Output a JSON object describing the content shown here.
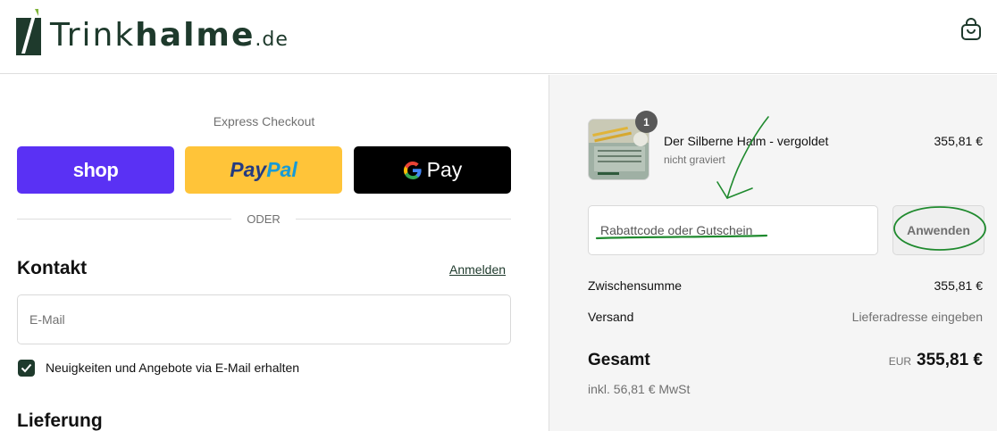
{
  "header": {
    "logo": {
      "part_light": "Trink",
      "part_bold": "halme",
      "tld": ".de"
    },
    "cart_icon": "shopping-bag-icon"
  },
  "express_checkout": {
    "title": "Express Checkout",
    "buttons": [
      {
        "id": "shop",
        "label": "shop"
      },
      {
        "id": "paypal",
        "label_part1": "Pay",
        "label_part2": "Pal"
      },
      {
        "id": "gpay",
        "label_g": "G",
        "label": "Pay"
      }
    ],
    "divider_label": "ODER"
  },
  "contact": {
    "title": "Kontakt",
    "login_link": "Anmelden",
    "email_placeholder": "E-Mail",
    "newsletter_label": "Neuigkeiten und Angebote via E-Mail erhalten",
    "newsletter_checked": true
  },
  "delivery": {
    "title": "Lieferung"
  },
  "order_summary": {
    "item": {
      "quantity": "1",
      "name": "Der Silberne Halm - vergoldet",
      "variant": "nicht graviert",
      "price": "355,81 €"
    },
    "discount": {
      "placeholder": "Rabattcode oder Gutschein",
      "apply_label": "Anwenden"
    },
    "subtotal_label": "Zwischensumme",
    "subtotal_value": "355,81 €",
    "shipping_label": "Versand",
    "shipping_value": "Lieferadresse eingeben",
    "total_label": "Gesamt",
    "total_currency": "EUR",
    "total_value": "355,81 €",
    "tax_note": "inkl. 56,81 € MwSt"
  },
  "colors": {
    "brand_green": "#1e3a2c",
    "shop_purple": "#5a31f4",
    "paypal_yellow": "#ffc439",
    "annotation_green": "#1f8a2e"
  }
}
